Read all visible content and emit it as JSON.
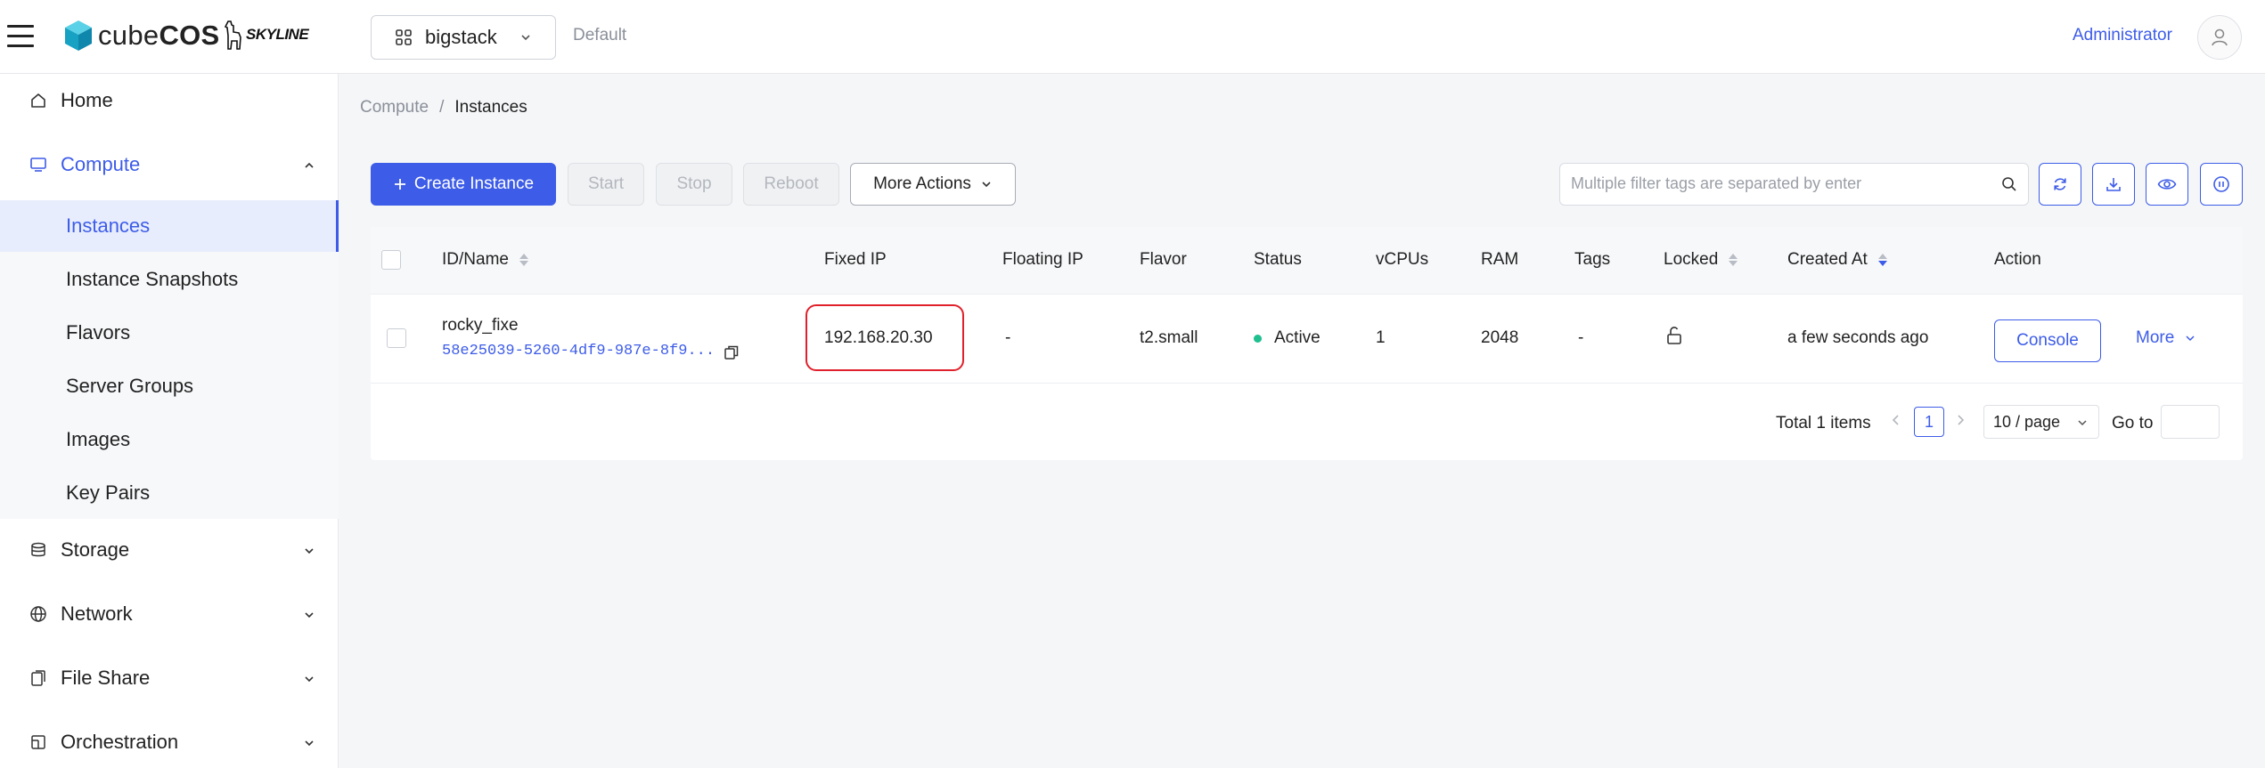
{
  "header": {
    "brand_prefix": "cube",
    "brand_suffix": "COS",
    "partner": "SKYLINE",
    "project": "bigstack",
    "domain": "Default",
    "user": "Administrator"
  },
  "sidebar": {
    "home": "Home",
    "compute": "Compute",
    "compute_items": [
      "Instances",
      "Instance Snapshots",
      "Flavors",
      "Server Groups",
      "Images",
      "Key Pairs"
    ],
    "storage": "Storage",
    "network": "Network",
    "file_share": "File Share",
    "orchestration": "Orchestration"
  },
  "breadcrumb": {
    "parent": "Compute",
    "separator": "/",
    "current": "Instances"
  },
  "toolbar": {
    "create": "Create Instance",
    "start": "Start",
    "stop": "Stop",
    "reboot": "Reboot",
    "more_actions": "More Actions",
    "search_placeholder": "Multiple filter tags are separated by enter"
  },
  "table": {
    "columns": [
      "ID/Name",
      "Fixed IP",
      "Floating IP",
      "Flavor",
      "Status",
      "vCPUs",
      "RAM",
      "Tags",
      "Locked",
      "Created At",
      "Action"
    ],
    "rows": [
      {
        "name": "rocky_fixe",
        "id": "58e25039-5260-4df9-987e-8f9...",
        "fixed_ip": "192.168.20.30",
        "floating_ip": "-",
        "flavor": "t2.small",
        "status": "Active",
        "vcpus": "1",
        "ram": "2048",
        "tags": "-",
        "created_at": "a few seconds ago",
        "console": "Console",
        "more": "More"
      }
    ]
  },
  "pagination": {
    "total": "Total 1 items",
    "current_page": "1",
    "page_size": "10 / page",
    "goto": "Go to"
  },
  "colors": {
    "accent": "#3d5ce8",
    "active_status": "#1fbf8f",
    "highlight": "#e0202a"
  }
}
